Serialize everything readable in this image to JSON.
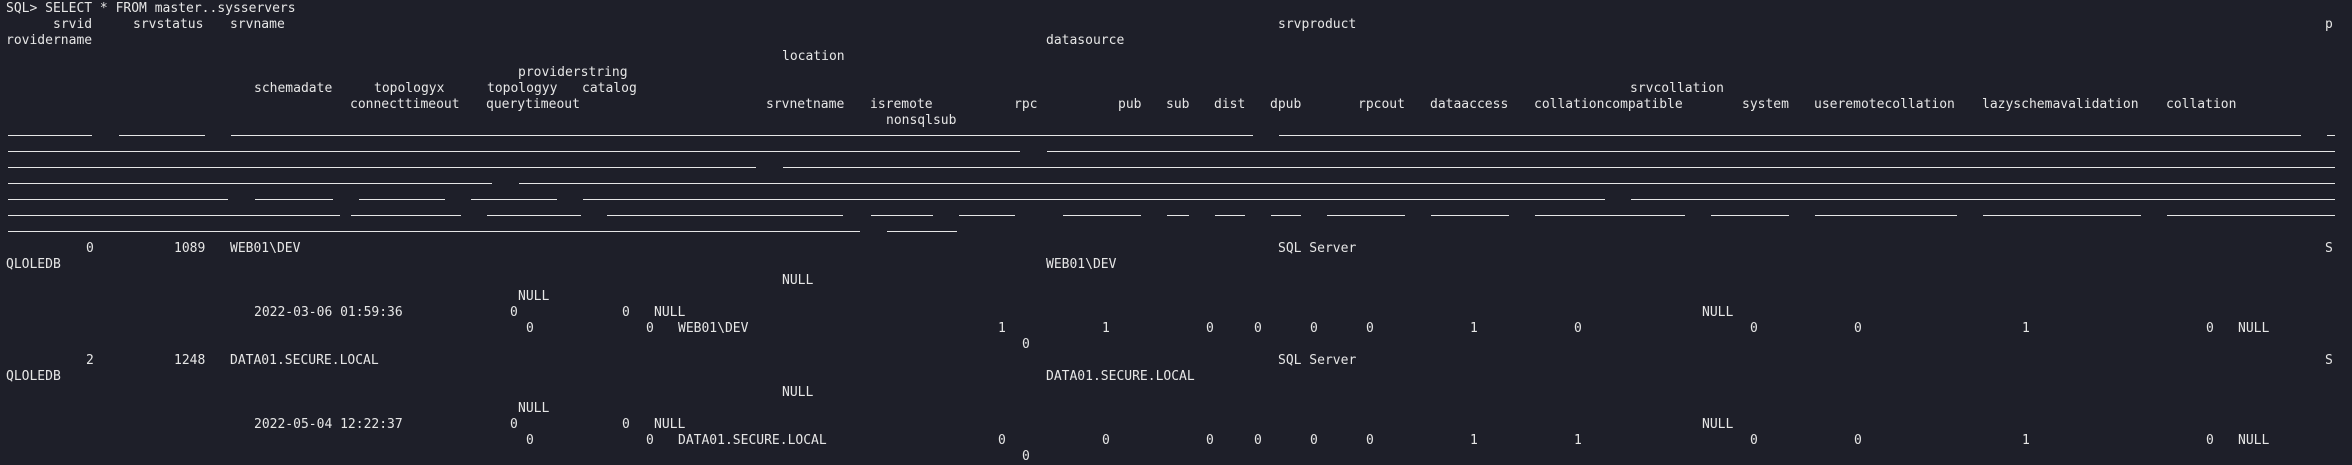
{
  "query": "SQL> SELECT * FROM master..sysservers",
  "headers": {
    "srvid": "srvid",
    "srvstatus": "srvstatus",
    "srvname": "srvname",
    "srvproduct": "srvproduct",
    "p_trail": "p",
    "providername_wrap": "rovidername",
    "datasource": "datasource",
    "location": "location",
    "providerstring": "providerstring",
    "schemadate": "schemadate",
    "topologyx": "topologyx",
    "topologyy": "topologyy",
    "catalog": "catalog",
    "srvcollation": "srvcollation",
    "connecttimeout": "connecttimeout",
    "querytimeout": "querytimeout",
    "srvnetname": "srvnetname",
    "isremote": "isremote",
    "rpc": "rpc",
    "pub": "pub",
    "sub": "sub",
    "dist": "dist",
    "dpub": "dpub",
    "rpcout": "rpcout",
    "dataaccess": "dataaccess",
    "collationcompatible": "collationcompatible",
    "system": "system",
    "useremotecollation": "useremotecollation",
    "lazyschemavalidation": "lazyschemavalidation",
    "collation": "collation",
    "nonsqlsub": "nonsqlsub"
  },
  "rows": [
    {
      "srvid": "0",
      "srvstatus": "1089",
      "srvname": "WEB01\\DEV",
      "srvproduct": "SQL Server",
      "provider_s": "S",
      "provider_rest": "QLOLEDB",
      "datasource": "WEB01\\DEV",
      "location": "NULL",
      "providerstring": "NULL",
      "schemadate": "2022-03-06 01:59:36",
      "topologyx": "0",
      "topologyy": "0",
      "catalog": "NULL",
      "srvcollation": "NULL",
      "connecttimeout": "0",
      "querytimeout": "0",
      "srvnetname": "WEB01\\DEV",
      "isremote": "1",
      "rpc": "1",
      "pub": "0",
      "sub": "0",
      "dist": "0",
      "dpub": "0",
      "rpcout": "1",
      "dataaccess": "0",
      "collationcompatible": "0",
      "system": "0",
      "useremotecollation": "1",
      "lazyschemavalidation": "0",
      "collation": "NULL",
      "nonsqlsub": "0"
    },
    {
      "srvid": "2",
      "srvstatus": "1248",
      "srvname": "DATA01.SECURE.LOCAL",
      "srvproduct": "SQL Server",
      "provider_s": "S",
      "provider_rest": "QLOLEDB",
      "datasource": "DATA01.SECURE.LOCAL",
      "location": "NULL",
      "providerstring": "NULL",
      "schemadate": "2022-05-04 12:22:37",
      "topologyx": "0",
      "topologyy": "0",
      "catalog": "NULL",
      "srvcollation": "NULL",
      "connecttimeout": "0",
      "querytimeout": "0",
      "srvnetname": "DATA01.SECURE.LOCAL",
      "isremote": "0",
      "rpc": "0",
      "pub": "0",
      "sub": "0",
      "dist": "0",
      "dpub": "0",
      "rpcout": "1",
      "dataaccess": "1",
      "collationcompatible": "0",
      "system": "0",
      "useremotecollation": "1",
      "lazyschemavalidation": "0",
      "collation": "NULL",
      "nonsqlsub": "0"
    }
  ]
}
